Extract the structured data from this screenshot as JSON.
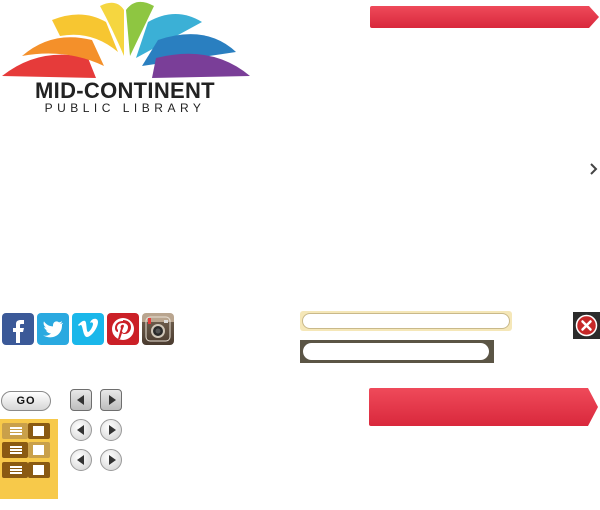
{
  "logo": {
    "name": "MID-CONTINENT",
    "tagline": "PUBLIC LIBRARY"
  },
  "search": {
    "go_label": "GO"
  },
  "social": [
    "facebook-icon",
    "twitter-icon",
    "vimeo-icon",
    "pinterest-icon",
    "instagram-icon"
  ],
  "colors": {
    "accent_red": "#e33a4c",
    "facebook": "#3b5998",
    "twitter": "#2aa9e0",
    "vimeo": "#1ab7ea",
    "pinterest": "#cb2027",
    "toggle_gold": "#f7c94a",
    "toggle_brown": "#8a5a12"
  }
}
